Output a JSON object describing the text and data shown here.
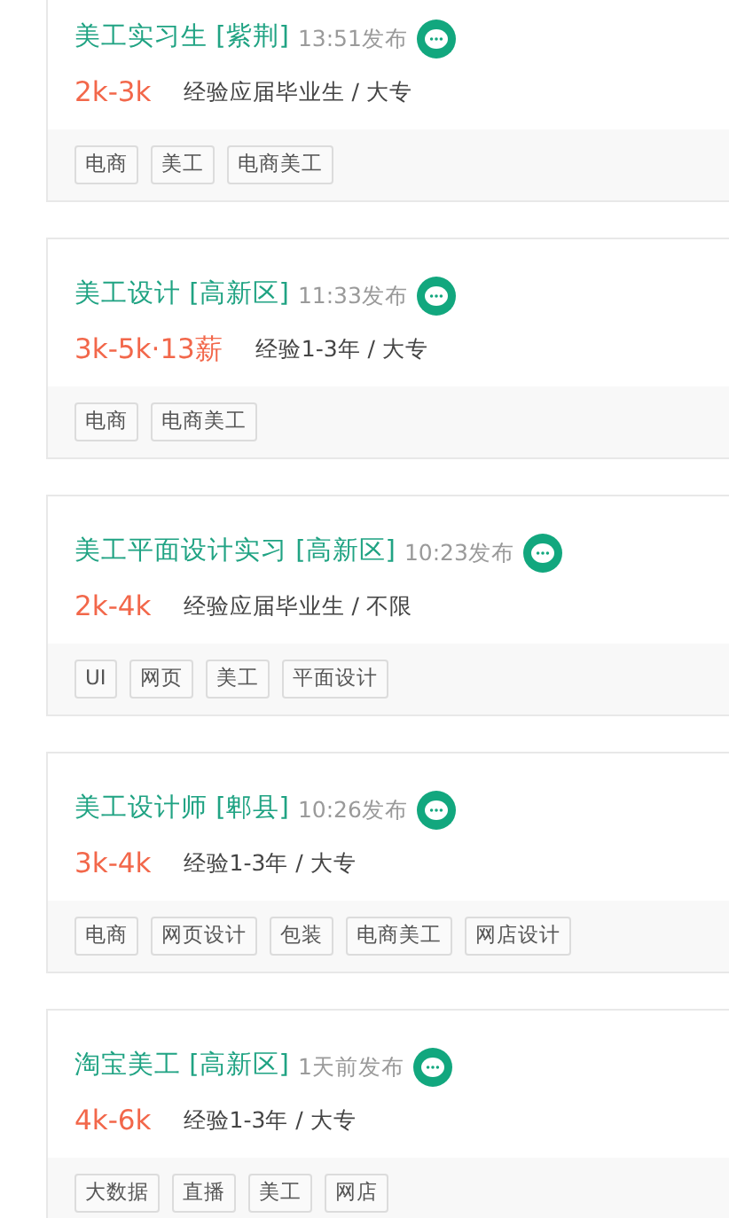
{
  "jobs": [
    {
      "title": "美工实习生 [紫荆]",
      "posted": "13:51发布",
      "salary": "2k-3k",
      "requirements": "经验应届毕业生 / 大专",
      "tags": [
        "电商",
        "美工",
        "电商美工"
      ]
    },
    {
      "title": "美工设计 [高新区]",
      "posted": "11:33发布",
      "salary": "3k-5k·13薪",
      "requirements": "经验1-3年 / 大专",
      "tags": [
        "电商",
        "电商美工"
      ]
    },
    {
      "title": "美工平面设计实习 [高新区]",
      "posted": "10:23发布",
      "salary": "2k-4k",
      "requirements": "经验应届毕业生 / 不限",
      "tags": [
        "UI",
        "网页",
        "美工",
        "平面设计"
      ]
    },
    {
      "title": "美工设计师 [郫县]",
      "posted": "10:26发布",
      "salary": "3k-4k",
      "requirements": "经验1-3年 / 大专",
      "tags": [
        "电商",
        "网页设计",
        "包装",
        "电商美工",
        "网店设计"
      ]
    },
    {
      "title": "淘宝美工 [高新区]",
      "posted": "1天前发布",
      "salary": "4k-6k",
      "requirements": "经验1-3年 / 大专",
      "tags": [
        "大数据",
        "直播",
        "美工",
        "网店"
      ]
    }
  ]
}
